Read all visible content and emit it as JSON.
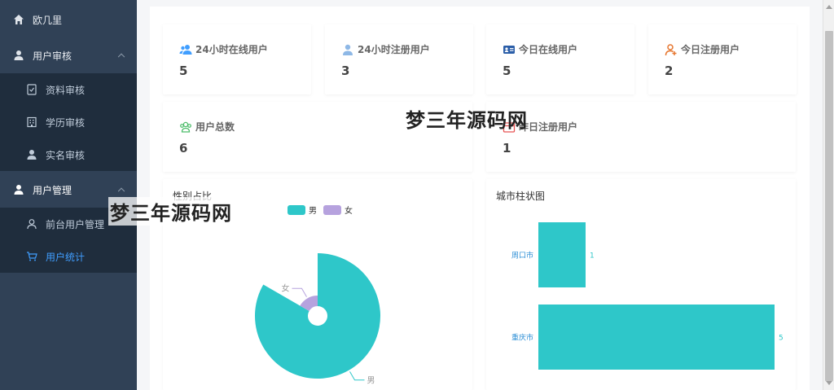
{
  "sidebar": {
    "items": [
      {
        "label": "欧几里",
        "icon": "home-icon"
      },
      {
        "label": "用户审核",
        "icon": "user-icon"
      },
      {
        "label": "资料审核",
        "icon": "document-check-icon"
      },
      {
        "label": "学历审核",
        "icon": "building-icon"
      },
      {
        "label": "实名审核",
        "icon": "user-icon"
      },
      {
        "label": "用户管理",
        "icon": "user-icon"
      },
      {
        "label": "前台用户管理",
        "icon": "user-outline-icon"
      },
      {
        "label": "用户统计",
        "icon": "cart-icon"
      }
    ],
    "active_color": "#409eff"
  },
  "stats": [
    {
      "title": "24小时在线用户",
      "value": "5",
      "icon": "users-icon",
      "color": "#409eff"
    },
    {
      "title": "24小时注册用户",
      "value": "3",
      "icon": "user-icon",
      "color": "#8eb8e6"
    },
    {
      "title": "今日在线用户",
      "value": "5",
      "icon": "id-card-icon",
      "color": "#2b5ea8"
    },
    {
      "title": "今日注册用户",
      "value": "2",
      "icon": "user-add-icon",
      "color": "#e6762f"
    },
    {
      "title": "用户总数",
      "value": "6",
      "icon": "group-icon",
      "color": "#4cbd6a"
    },
    {
      "title": "昨日注册用户",
      "value": "1",
      "icon": "calendar-icon",
      "color": "#e85555"
    }
  ],
  "gender_chart": {
    "title": "性别占比",
    "chart_data": {
      "type": "pie",
      "roseType": "radius",
      "labels": [
        "男",
        "女"
      ],
      "values": [
        5,
        1
      ],
      "colors": [
        "#2ec7c9",
        "#b6a2de"
      ],
      "legend": "top"
    }
  },
  "city_chart": {
    "title": "城市柱状图",
    "chart_data": {
      "type": "bar",
      "orientation": "horizontal",
      "categories": [
        "周口市",
        "重庆市"
      ],
      "values": [
        1,
        5
      ],
      "color": "#2ec7c9"
    }
  },
  "watermark": "梦三年源码网"
}
